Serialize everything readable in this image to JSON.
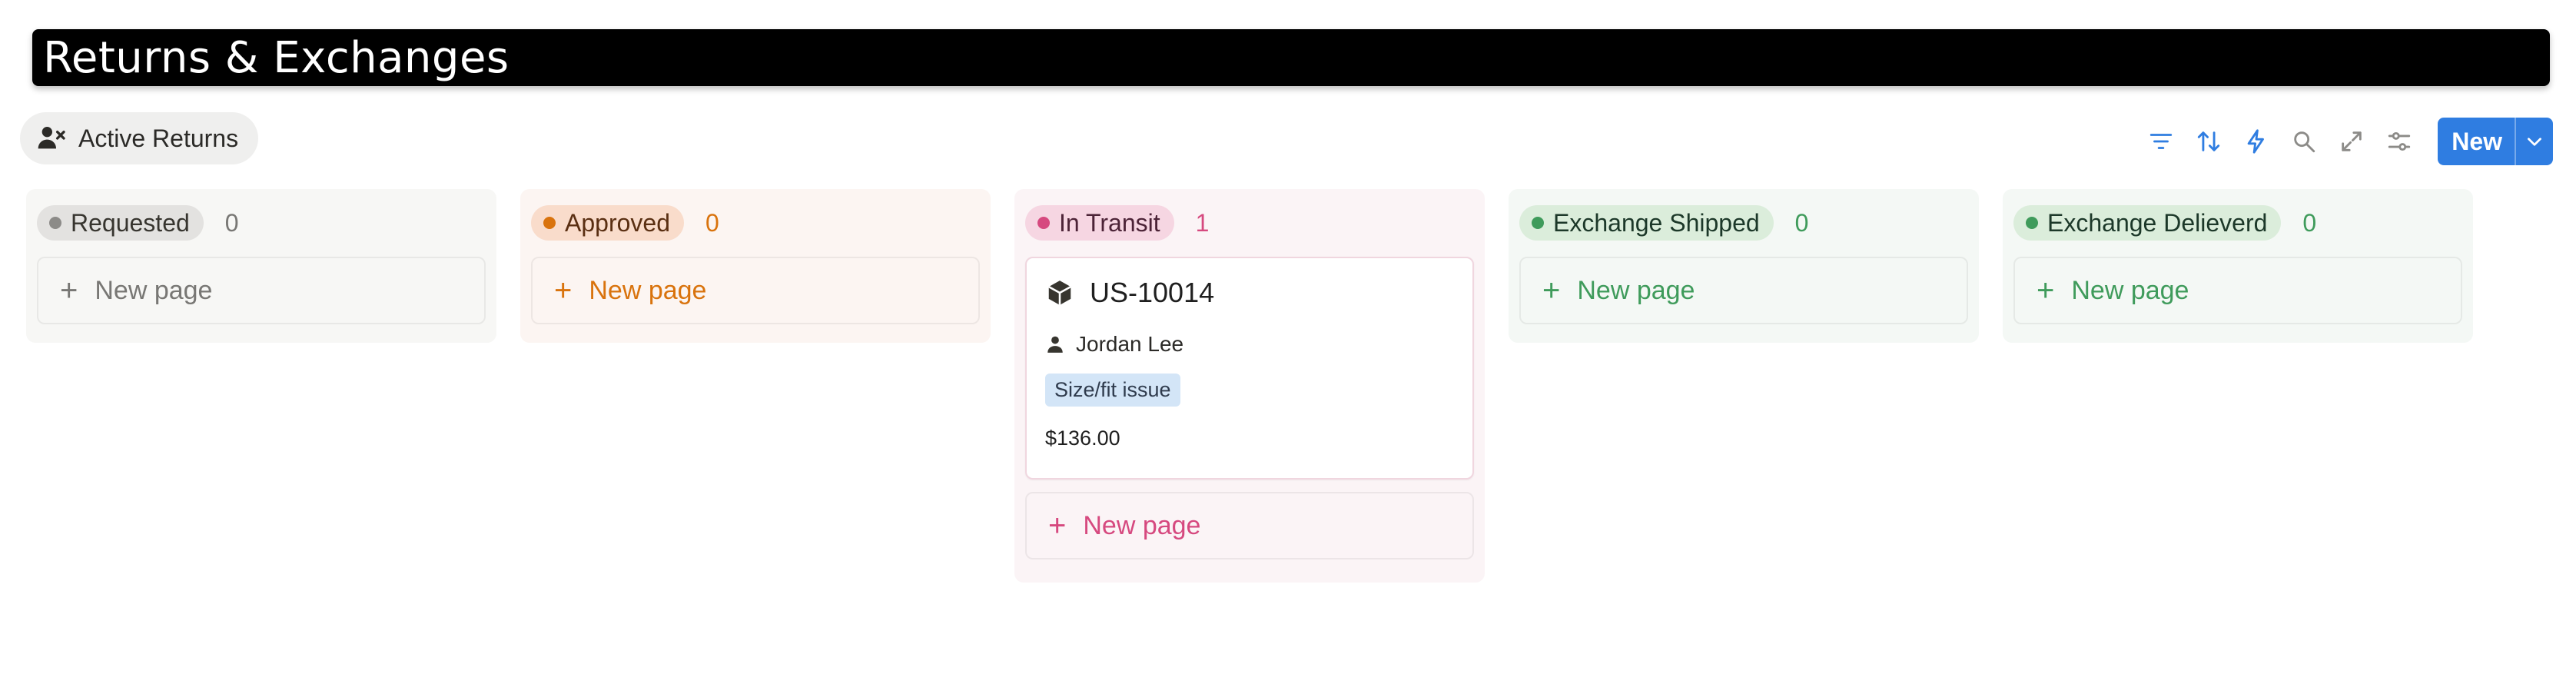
{
  "header": {
    "title": "Returns & Exchanges"
  },
  "view_tab": {
    "label": "Active Returns",
    "icon": "person-remove-icon"
  },
  "toolbar": {
    "icons": [
      "filter-icon",
      "sort-icon",
      "automation-icon",
      "search-icon",
      "expand-icon",
      "settings-icon"
    ],
    "accent": "#2f7de1",
    "new_label": "New"
  },
  "columns": [
    {
      "name": "Requested",
      "count": "0",
      "new_page": "New page",
      "bg": "#f7f7f5",
      "pill_bg": "#e3e2e0",
      "dot": "#8c8b88",
      "fg": "#37352f",
      "count_color": "#787774"
    },
    {
      "name": "Approved",
      "count": "0",
      "new_page": "New page",
      "bg": "#fcf5f2",
      "pill_bg": "#f9dccb",
      "dot": "#d9730d",
      "fg": "#5a2f12",
      "count_color": "#d9730d"
    },
    {
      "name": "In Transit",
      "count": "1",
      "new_page": "New page",
      "bg": "#fbf4f6",
      "pill_bg": "#f6d6e2",
      "dot": "#d6497f",
      "fg": "#4c2337",
      "count_color": "#d6497f",
      "cards": [
        {
          "id": "US-10014",
          "icon": "package-icon",
          "customer": "Jordan Lee",
          "person_icon": "person-icon",
          "tag": "Size/fit issue",
          "amount": "$136.00"
        }
      ]
    },
    {
      "name": "Exchange Shipped",
      "count": "0",
      "new_page": "New page",
      "bg": "#f4f8f5",
      "pill_bg": "#dbeddb",
      "dot": "#3f9b5b",
      "fg": "#1c3829",
      "count_color": "#3f9b5b"
    },
    {
      "name": "Exchange Delieverd",
      "count": "0",
      "new_page": "New page",
      "bg": "#f4f8f5",
      "pill_bg": "#dbeddb",
      "dot": "#3f9b5b",
      "fg": "#1c3829",
      "count_color": "#3f9b5b"
    }
  ]
}
